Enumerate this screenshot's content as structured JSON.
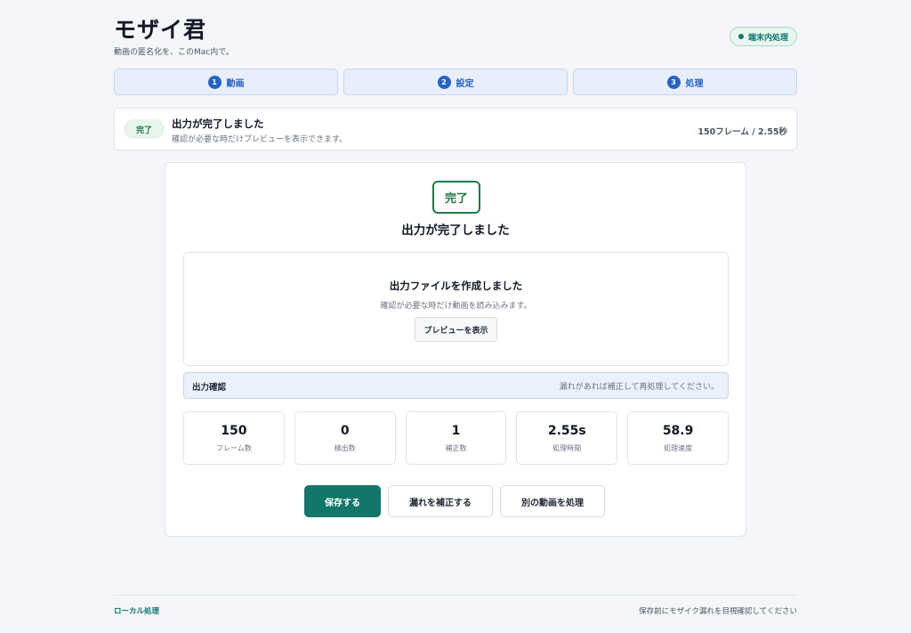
{
  "app": {
    "title": "モザイ君",
    "subtitle": "動画の匿名化を、このMac内で。",
    "badge": "端末内処理"
  },
  "steps": [
    {
      "num": "1",
      "label": "動画"
    },
    {
      "num": "2",
      "label": "設定"
    },
    {
      "num": "3",
      "label": "処理"
    }
  ],
  "status": {
    "pill": "完了",
    "title": "出力が完了しました",
    "desc": "確認が必要な時だけプレビューを表示できます。",
    "meta": "150フレーム / 2.55秒"
  },
  "result": {
    "badge": "完了",
    "title": "出力が完了しました",
    "file_title": "出力ファイルを作成しました",
    "file_desc": "確認が必要な時だけ動画を読み込みます。",
    "preview_button": "プレビューを表示"
  },
  "check": {
    "label": "出力確認",
    "hint": "漏れがあれば補正して再処理してください。"
  },
  "stats": [
    {
      "value": "150",
      "label": "フレーム数"
    },
    {
      "value": "0",
      "label": "検出数"
    },
    {
      "value": "1",
      "label": "補正数"
    },
    {
      "value": "2.55s",
      "label": "処理時間"
    },
    {
      "value": "58.9",
      "label": "処理速度"
    }
  ],
  "actions": {
    "save": "保存する",
    "fix": "漏れを補正する",
    "other": "別の動画を処理"
  },
  "footer": {
    "left": "ローカル処理",
    "right": "保存前にモザイク漏れを目視確認してください"
  },
  "colors": {
    "accent": "#12766a",
    "step_blue": "#2563c9",
    "success": "#1f7a43"
  }
}
